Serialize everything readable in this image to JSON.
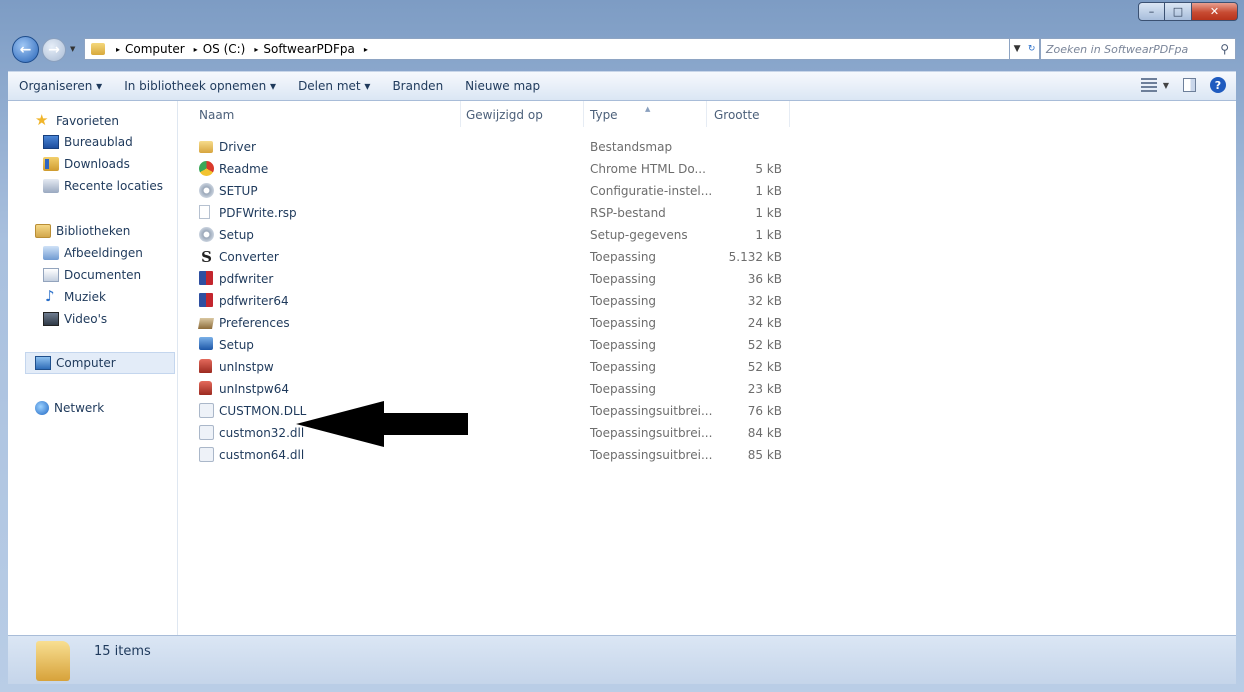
{
  "window": {
    "minimize_glyph": "–",
    "maximize_glyph": "□",
    "close_glyph": "✕"
  },
  "address": {
    "crumbs": [
      "Computer",
      "OS (C:)",
      "SoftwearPDFpa"
    ],
    "separator": "▸"
  },
  "search": {
    "placeholder": "Zoeken in SoftwearPDFpa",
    "icon": "search-icon"
  },
  "toolbar": {
    "organize": "Organiseren ▾",
    "include_library": "In bibliotheek opnemen ▾",
    "share": "Delen met ▾",
    "burn": "Branden",
    "new_folder": "Nieuwe map"
  },
  "nav": {
    "favorites": "Favorieten",
    "desktop": "Bureaublad",
    "downloads": "Downloads",
    "recent": "Recente locaties",
    "libraries": "Bibliotheken",
    "pictures": "Afbeeldingen",
    "documents": "Documenten",
    "music": "Muziek",
    "videos": "Video's",
    "computer": "Computer",
    "network": "Netwerk"
  },
  "columns": {
    "name": "Naam",
    "modified": "Gewijzigd op",
    "type": "Type",
    "size": "Grootte"
  },
  "files": [
    {
      "name": "Driver",
      "type": "Bestandsmap",
      "size": "",
      "icon": "folder-icon"
    },
    {
      "name": "Readme",
      "type": "Chrome HTML Do...",
      "size": "5 kB",
      "icon": "chrome-icon"
    },
    {
      "name": "SETUP",
      "type": "Configuratie-instel...",
      "size": "1 kB",
      "icon": "config-icon"
    },
    {
      "name": "PDFWrite.rsp",
      "type": "RSP-bestand",
      "size": "1 kB",
      "icon": "file-icon"
    },
    {
      "name": "Setup",
      "type": "Setup-gegevens",
      "size": "1 kB",
      "icon": "config-icon"
    },
    {
      "name": "Converter",
      "type": "Toepassing",
      "size": "5.132 kB",
      "icon": "app-s-icon"
    },
    {
      "name": "pdfwriter",
      "type": "Toepassing",
      "size": "36 kB",
      "icon": "pdf-app-icon"
    },
    {
      "name": "pdfwriter64",
      "type": "Toepassing",
      "size": "32 kB",
      "icon": "pdf-app-icon"
    },
    {
      "name": "Preferences",
      "type": "Toepassing",
      "size": "24 kB",
      "icon": "preferences-icon"
    },
    {
      "name": "Setup",
      "type": "Toepassing",
      "size": "52 kB",
      "icon": "setup-icon"
    },
    {
      "name": "unInstpw",
      "type": "Toepassing",
      "size": "52 kB",
      "icon": "uninstall-icon"
    },
    {
      "name": "unInstpw64",
      "type": "Toepassing",
      "size": "23 kB",
      "icon": "uninstall-icon"
    },
    {
      "name": "CUSTMON.DLL",
      "type": "Toepassingsuitbrei...",
      "size": "76 kB",
      "icon": "dll-icon"
    },
    {
      "name": "custmon32.dll",
      "type": "Toepassingsuitbrei...",
      "size": "84 kB",
      "icon": "dll-icon"
    },
    {
      "name": "custmon64.dll",
      "type": "Toepassingsuitbrei...",
      "size": "85 kB",
      "icon": "dll-icon"
    }
  ],
  "status": {
    "count": "15 items"
  }
}
